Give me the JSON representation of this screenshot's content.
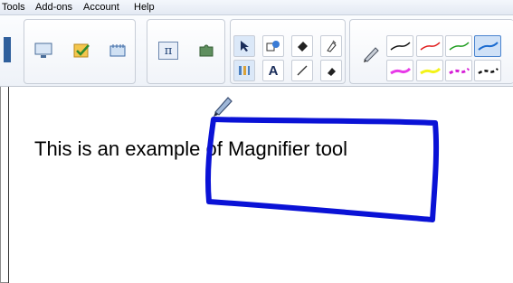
{
  "menu": {
    "items": [
      "Tools",
      "Add-ons",
      "Account",
      "Help"
    ]
  },
  "toolbar": {
    "icons": {
      "screen": "screen-icon",
      "checkbox": "checkbox-icon",
      "calendar": "calendar-icon",
      "pi": "pi-icon",
      "puzzle": "puzzle-icon",
      "select": "arrow-cursor-icon",
      "shapes": "shapes-icon",
      "fill": "fill-icon",
      "highlighter": "highlighter-icon",
      "pen_text": "pen-text-icon",
      "text": "text-icon",
      "line": "line-icon",
      "eraser": "eraser-icon",
      "pen": "pen-icon"
    },
    "text_tool_label": "A",
    "pi_label": "π"
  },
  "canvas": {
    "sample_text": "This is an example of Magnifier tool"
  },
  "colors": {
    "stroke_blue": "#0a12d6",
    "accent": "#1a6bd0"
  }
}
